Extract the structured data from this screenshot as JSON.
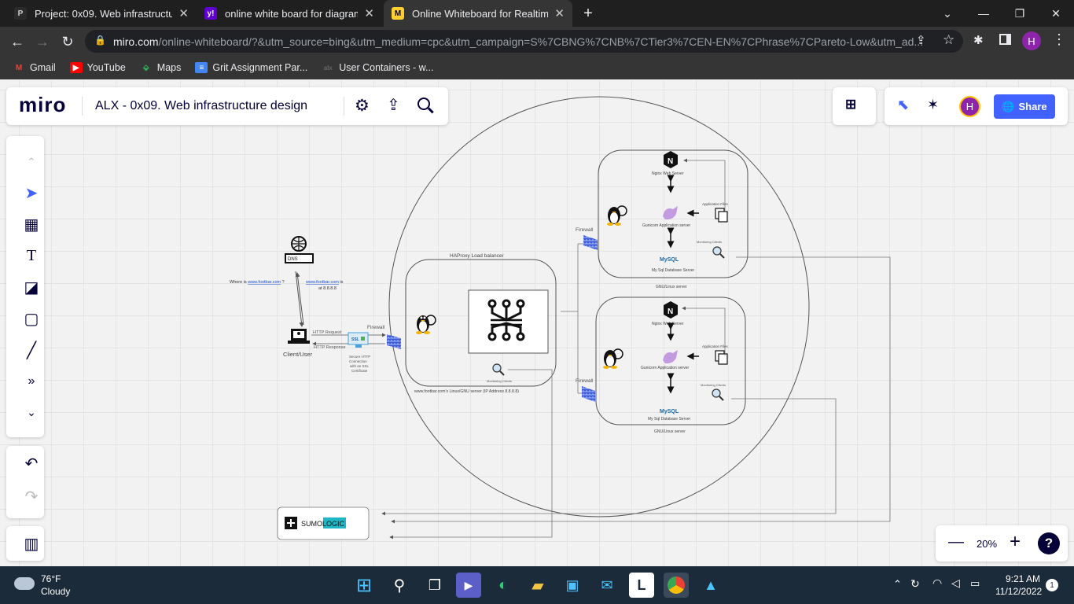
{
  "browser": {
    "tabs": [
      {
        "title": "Project: 0x09. Web infrastructure",
        "fav": "P",
        "active": false
      },
      {
        "title": "online white board for diagrams",
        "fav": "y!",
        "active": false
      },
      {
        "title": "Online Whiteboard for Realtime C",
        "fav": "M",
        "active": true
      }
    ],
    "url_host": "miro.com",
    "url_path": "/online-whiteboard/?&utm_source=bing&utm_medium=cpc&utm_campaign=S%7CBNG%7CNB%7CTier3%7CEN-EN%7CPhrase%7CPareto-Low&utm_ad...",
    "profile_initial": "H",
    "bookmarks": [
      "Gmail",
      "YouTube",
      "Maps",
      "Grit Assignment Par...",
      "User Containers - w..."
    ]
  },
  "miro": {
    "logo": "miro",
    "board_title": "ALX - 0x09. Web infrastructure design",
    "share_label": "Share",
    "avatar_initial": "H",
    "zoom": "20%",
    "help": "?",
    "accent": "#4262ff"
  },
  "diagram": {
    "dns_label": "DNS",
    "dns_q_prefix": "Where is ",
    "dns_q_link": "www.footbar.com",
    "dns_q_suffix": " ?",
    "dns_a_link": "www.footbar.com",
    "dns_a_suffix": " is",
    "dns_a_line2": "at 8.8.8.8",
    "client_label": "Client/User",
    "http_request": "HTTP Request",
    "http_response": "HTTP Response",
    "ssl_label": "SSL",
    "ssl_caption": [
      "Secure HTTP",
      "Connection",
      "with an SSL",
      "Certificate"
    ],
    "firewall": "Firewall",
    "lb_title": "HAProxy Load balancer",
    "lb_caption": "www.footbar.com's Linux/GNU server (IP Address 8.8.8.8)",
    "monitoring_clients": "Monitoring Clients",
    "nginx": "Nginx Web Server",
    "app_files": "Application Files",
    "gunicorn": "Gunicorn Application server",
    "mysql": "My Sql Database Server",
    "gnu_linux": "GNU/Linux server",
    "mysql_logo": "MySQL",
    "sumo_a": "SUMO",
    "sumo_b": "LOGIC"
  },
  "taskbar": {
    "temp": "76°F",
    "weather": "Cloudy",
    "time": "9:21 AM",
    "date": "11/12/2022",
    "notifications": "1"
  }
}
